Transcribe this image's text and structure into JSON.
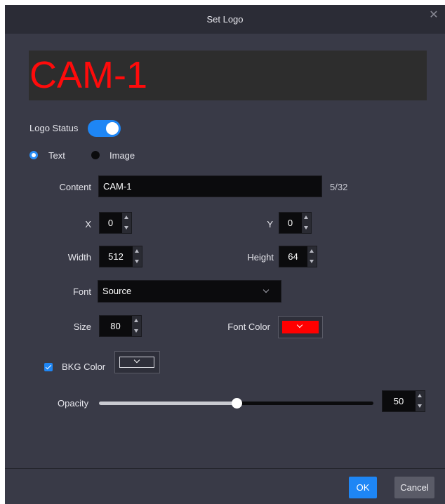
{
  "dialog": {
    "title": "Set Logo",
    "close_icon": "close-icon"
  },
  "preview": {
    "text": "CAM-1",
    "text_color": "#ff0b0b",
    "background_color": "#2d2d2d"
  },
  "logo_status": {
    "label": "Logo Status",
    "enabled": true,
    "accent_color": "#1e86f5"
  },
  "type_options": [
    {
      "label": "Text",
      "selected": true
    },
    {
      "label": "Image",
      "selected": false
    }
  ],
  "content": {
    "label": "Content",
    "value": "CAM-1",
    "counter": "5/32"
  },
  "position": {
    "x_label": "X",
    "x_value": "0",
    "y_label": "Y",
    "y_value": "0"
  },
  "dimensions": {
    "width_label": "Width",
    "width_value": "512",
    "height_label": "Height",
    "height_value": "64"
  },
  "font": {
    "label": "Font",
    "value": "Source"
  },
  "size": {
    "label": "Size",
    "value": "80"
  },
  "font_color": {
    "label": "Font Color",
    "color": "#ff0000"
  },
  "bkg_color": {
    "label": "BKG Color",
    "checked": true,
    "color": "#2e2f3a"
  },
  "opacity": {
    "label": "Opacity",
    "value": "50",
    "fraction": 0.5
  },
  "buttons": {
    "ok": "OK",
    "cancel": "Cancel"
  }
}
